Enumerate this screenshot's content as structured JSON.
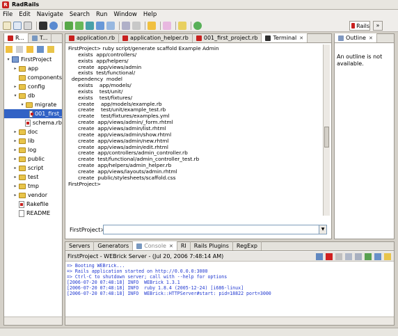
{
  "window": {
    "title": "RadRails",
    "icon_letter": "R"
  },
  "menu": [
    "File",
    "Edit",
    "Navigate",
    "Search",
    "Run",
    "Window",
    "Help"
  ],
  "perspective": {
    "label": "Rails",
    "accent": "#c8201e"
  },
  "left_panel": {
    "tabs": [
      {
        "label": "R...",
        "active": true
      },
      {
        "label": "T..."
      }
    ],
    "tree": [
      {
        "label": "FirstProject",
        "depth": 0,
        "type": "project",
        "twisty": "▾"
      },
      {
        "label": "app",
        "depth": 1,
        "type": "folder",
        "twisty": "▸"
      },
      {
        "label": "components",
        "depth": 1,
        "type": "folder",
        "twisty": ""
      },
      {
        "label": "config",
        "depth": 1,
        "type": "folder",
        "twisty": "▸"
      },
      {
        "label": "db",
        "depth": 1,
        "type": "folder",
        "twisty": "▾"
      },
      {
        "label": "migrate",
        "depth": 2,
        "type": "folder",
        "twisty": "▾"
      },
      {
        "label": "001_first_",
        "depth": 3,
        "type": "rbfile",
        "twisty": "",
        "selected": true
      },
      {
        "label": "schema.rb",
        "depth": 2,
        "type": "rbfile",
        "twisty": ""
      },
      {
        "label": "doc",
        "depth": 1,
        "type": "folder",
        "twisty": "▸"
      },
      {
        "label": "lib",
        "depth": 1,
        "type": "folder",
        "twisty": "▸"
      },
      {
        "label": "log",
        "depth": 1,
        "type": "folder",
        "twisty": "▸"
      },
      {
        "label": "public",
        "depth": 1,
        "type": "folder",
        "twisty": "▸"
      },
      {
        "label": "script",
        "depth": 1,
        "type": "folder",
        "twisty": "▸"
      },
      {
        "label": "test",
        "depth": 1,
        "type": "folder",
        "twisty": "▸"
      },
      {
        "label": "tmp",
        "depth": 1,
        "type": "folder",
        "twisty": "▸"
      },
      {
        "label": "vendor",
        "depth": 1,
        "type": "folder",
        "twisty": "▸"
      },
      {
        "label": "Rakefile",
        "depth": 1,
        "type": "rbfile",
        "twisty": ""
      },
      {
        "label": "README",
        "depth": 1,
        "type": "file",
        "twisty": ""
      }
    ]
  },
  "editor": {
    "tabs": [
      {
        "label": "application.rb"
      },
      {
        "label": "application_helper.rb"
      },
      {
        "label": "001_first_project.rb"
      },
      {
        "label": "Terminal",
        "active": true,
        "closable": true
      }
    ],
    "terminal_lines": [
      "FirstProject> ruby script/generate scaffold Example Admin",
      "      exists  app/controllers/",
      "      exists  app/helpers/",
      "      create  app/views/admin",
      "      exists  test/functional/",
      "  dependency  model",
      "      exists    app/models/",
      "      exists    test/unit/",
      "      exists    test/fixtures/",
      "      create    app/models/example.rb",
      "      create    test/unit/example_test.rb",
      "      create    test/fixtures/examples.yml",
      "      create  app/views/admin/_form.rhtml",
      "      create  app/views/admin/list.rhtml",
      "      create  app/views/admin/show.rhtml",
      "      create  app/views/admin/new.rhtml",
      "      create  app/views/admin/edit.rhtml",
      "      create  app/controllers/admin_controller.rb",
      "      create  test/functional/admin_controller_test.rb",
      "      create  app/helpers/admin_helper.rb",
      "      create  app/views/layouts/admin.rhtml",
      "      create  public/stylesheets/scaffold.css",
      "FirstProject>"
    ],
    "prompt_label": "FirstProject>",
    "input_value": ""
  },
  "outline": {
    "tab_label": "Outline",
    "message": "An outline is not available."
  },
  "console": {
    "tabs": [
      {
        "label": "Servers"
      },
      {
        "label": "Generators"
      },
      {
        "label": "Console",
        "active": true,
        "closable": true
      },
      {
        "label": "RI"
      },
      {
        "label": "Rails Plugins"
      },
      {
        "label": "RegExp"
      }
    ],
    "header": "FirstProject - WEBrick Server - (Jul 20, 2006 7:48:14 AM)",
    "lines": [
      "=> Booting WEBrick...",
      "=> Rails application started on http://0.0.0.0:3000",
      "=> Ctrl-C to shutdown server; call with --help for options",
      "[2006-07-20 07:48:18] INFO  WEBrick 1.3.1",
      "[2006-07-20 07:48:18] INFO  ruby 1.8.4 (2005-12-24) [i686-linux]",
      "[2006-07-20 07:48:18] INFO  WEBrick::HTTPServer#start: pid=18822 port=3000"
    ],
    "text_color": "#2038d0"
  }
}
